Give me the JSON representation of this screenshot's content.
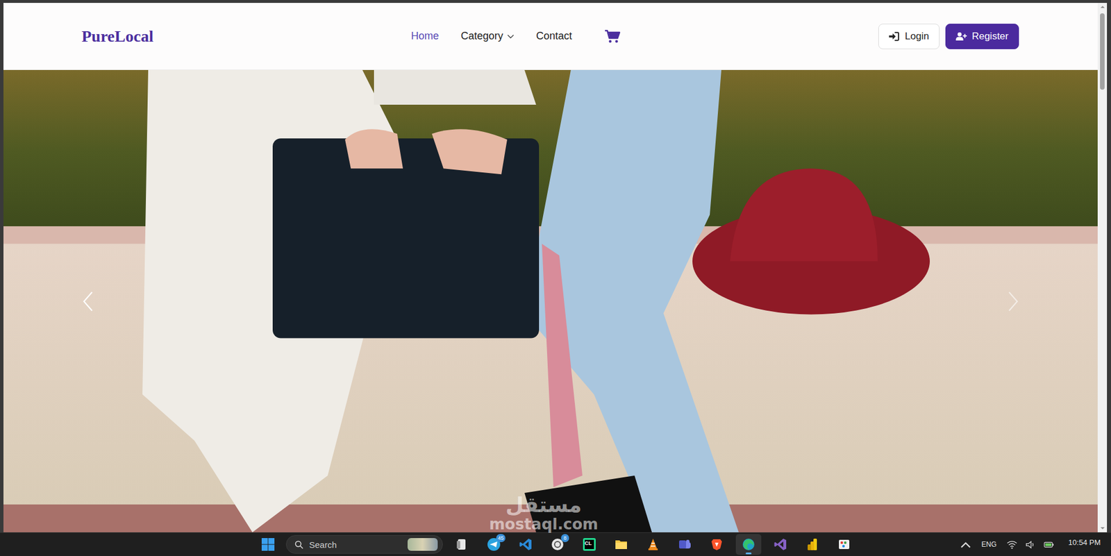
{
  "site": {
    "logo": "PureLocal"
  },
  "nav": {
    "links": [
      {
        "label": "Home",
        "selected": true,
        "dropdown": false
      },
      {
        "label": "Category",
        "selected": false,
        "dropdown": true
      },
      {
        "label": "Contact",
        "selected": false,
        "dropdown": false
      }
    ]
  },
  "auth_buttons": [
    {
      "label": "Login",
      "kind": "outline"
    },
    {
      "label": "Register",
      "kind": "primary"
    }
  ],
  "scrollbar": {
    "level": 0.15
  },
  "watermark": {
    "arabic": "مستقل",
    "latin": "mostaql.com"
  },
  "taskbar": {
    "search_placeholder": "Search",
    "apps": [
      {
        "kind": "widgets",
        "label": null,
        "badge": null,
        "active": false
      },
      {
        "kind": "telegram",
        "label": null,
        "badge": "45",
        "active": false
      },
      {
        "kind": "vscode",
        "label": null,
        "badge": null,
        "active": false
      },
      {
        "kind": "chat",
        "label": null,
        "badge": "8",
        "active": false
      },
      {
        "kind": "clion",
        "label": "CL",
        "badge": null,
        "active": false
      },
      {
        "kind": "folder",
        "label": null,
        "badge": null,
        "active": false
      },
      {
        "kind": "vlc",
        "label": null,
        "badge": null,
        "active": false
      },
      {
        "kind": "teams",
        "label": null,
        "badge": null,
        "active": false
      },
      {
        "kind": "brave",
        "label": null,
        "badge": null,
        "active": false
      },
      {
        "kind": "edge",
        "label": null,
        "badge": null,
        "active": true
      },
      {
        "kind": "vstudio",
        "label": null,
        "badge": null,
        "active": false
      },
      {
        "kind": "powerbi",
        "label": null,
        "badge": null,
        "active": false
      },
      {
        "kind": "paint",
        "label": null,
        "badge": null,
        "active": false
      }
    ],
    "tray": {
      "language": "ENG",
      "time": "10:54 PM"
    }
  }
}
